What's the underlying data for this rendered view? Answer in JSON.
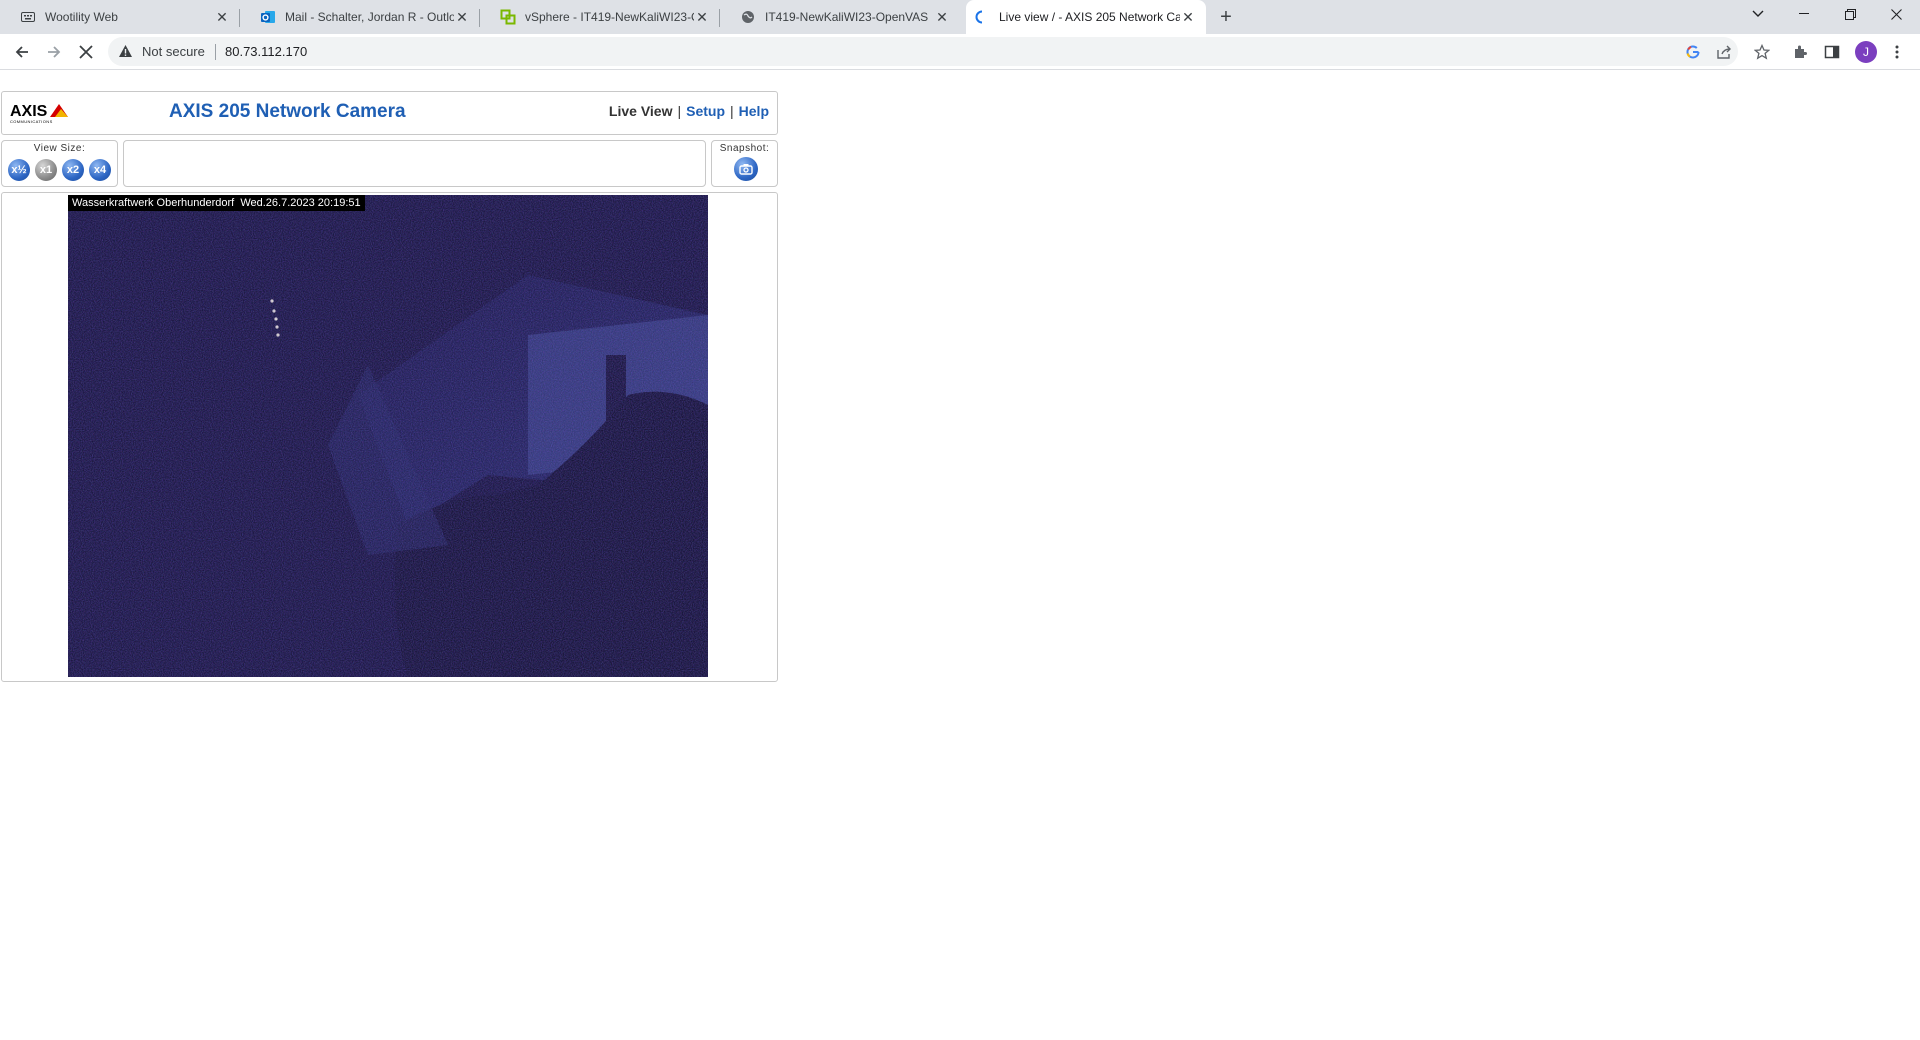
{
  "browser": {
    "tabs": [
      {
        "title": "Wootility Web",
        "icon": "keyboard-icon"
      },
      {
        "title": "Mail - Schalter, Jordan R - Outloo",
        "icon": "outlook-icon"
      },
      {
        "title": "vSphere - IT419-NewKaliWI23-Op",
        "icon": "vsphere-icon"
      },
      {
        "title": "IT419-NewKaliWI23-OpenVAS",
        "icon": "globe-icon"
      },
      {
        "title": "Live view / - AXIS 205 Network Ca",
        "icon": "loading-icon"
      }
    ],
    "address": {
      "security_label": "Not secure",
      "url": "80.73.112.170"
    },
    "profile_initial": "J"
  },
  "camera_page": {
    "logo_text": "AXIS",
    "logo_subtext": "COMMUNICATIONS",
    "title": "AXIS 205 Network Camera",
    "nav": {
      "live_view": "Live View",
      "separator": "|",
      "setup": "Setup",
      "help": "Help"
    },
    "view_size": {
      "label": "View Size:",
      "buttons": [
        "x½",
        "x1",
        "x2",
        "x4"
      ],
      "selected": "x1"
    },
    "snapshot_label": "Snapshot:",
    "video_overlay": "Wasserkraftwerk Oberhunderdorf  Wed.26.7.2023 20:19:51"
  },
  "colors": {
    "link": "#1f5fb4",
    "accent_red": "#d40000",
    "accent_yellow": "#f2b400"
  }
}
